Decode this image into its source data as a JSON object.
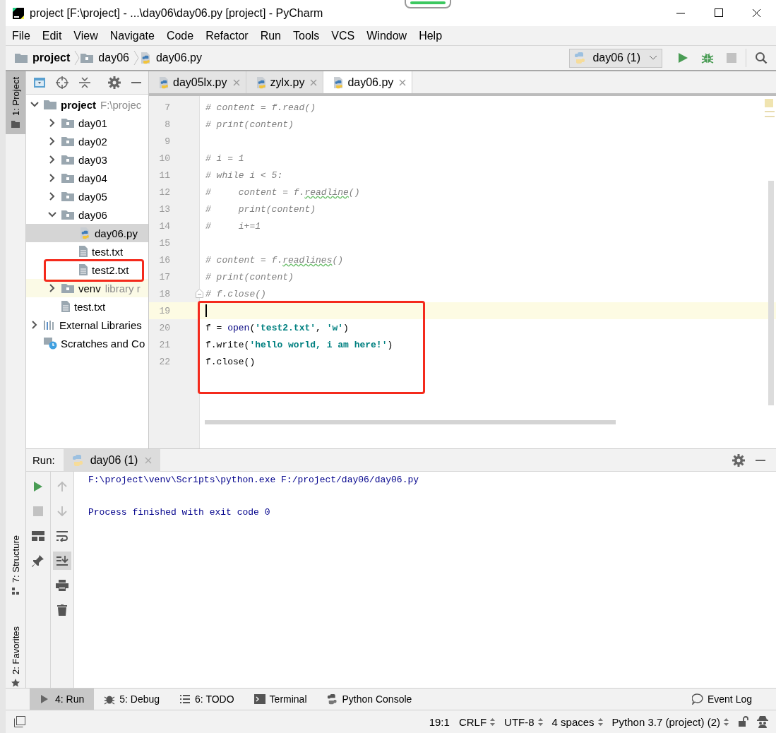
{
  "window": {
    "title": "project [F:\\project] - ...\\day06\\day06.py [project] - PyCharm"
  },
  "menu": [
    "File",
    "Edit",
    "View",
    "Navigate",
    "Code",
    "Refactor",
    "Run",
    "Tools",
    "VCS",
    "Window",
    "Help"
  ],
  "breadcrumbs": [
    {
      "label": "project",
      "kind": "root"
    },
    {
      "label": "day06",
      "kind": "folder"
    },
    {
      "label": "day06.py",
      "kind": "pyfile"
    }
  ],
  "run_config": {
    "label": "day06 (1)"
  },
  "side_tabs_top": [
    {
      "label": "1: Project",
      "selected": true
    }
  ],
  "side_tabs_bottom": [
    {
      "label": "7: Structure",
      "selected": false
    },
    {
      "label": "2: Favorites",
      "selected": false
    }
  ],
  "tree": [
    {
      "label": "project",
      "hint": "F:\\projec",
      "kind": "root",
      "expanded": true,
      "selected": false,
      "children": [
        {
          "label": "day01",
          "kind": "folder",
          "expanded": false,
          "selected": false
        },
        {
          "label": "day02",
          "kind": "folder",
          "expanded": false,
          "selected": false
        },
        {
          "label": "day03",
          "kind": "folder",
          "expanded": false,
          "selected": false
        },
        {
          "label": "day04",
          "kind": "folder",
          "expanded": false,
          "selected": false
        },
        {
          "label": "day05",
          "kind": "folder",
          "expanded": false,
          "selected": false
        },
        {
          "label": "day06",
          "kind": "folder",
          "expanded": true,
          "selected": false,
          "children": [
            {
              "label": "day06.py",
              "kind": "pyfile",
              "selected": true
            },
            {
              "label": "test.txt",
              "kind": "txtfile",
              "selected": false
            },
            {
              "label": "test2.txt",
              "kind": "txtfile",
              "selected": false,
              "annotated": true
            }
          ]
        },
        {
          "label": "venv",
          "hint": "library r",
          "kind": "folder",
          "expanded": false,
          "selected": false,
          "library": true
        },
        {
          "label": "test.txt",
          "kind": "txtfile",
          "selected": false
        }
      ]
    },
    {
      "label": "External Libraries",
      "kind": "libraries",
      "expanded": false,
      "selected": false
    },
    {
      "label": "Scratches and Co",
      "kind": "scratches",
      "selected": false
    }
  ],
  "editor_tabs": [
    {
      "label": "day05lx.py",
      "selected": false
    },
    {
      "label": "zylx.py",
      "selected": false
    },
    {
      "label": "day06.py",
      "selected": true
    }
  ],
  "code": [
    {
      "number": "7",
      "tokens": [
        {
          "kind": "comment",
          "text": "# content = f.read()"
        }
      ]
    },
    {
      "number": "8",
      "tokens": [
        {
          "kind": "comment",
          "text": "# print(content)"
        }
      ]
    },
    {
      "number": "9"
    },
    {
      "number": "10",
      "tokens": [
        {
          "kind": "comment",
          "text": "# i = 1"
        }
      ]
    },
    {
      "number": "11",
      "tokens": [
        {
          "kind": "comment",
          "text": "# while i < 5:"
        }
      ]
    },
    {
      "number": "12",
      "tokens": [
        {
          "kind": "comment",
          "text": "#     content = f."
        },
        {
          "kind": "comment_typo",
          "text": "readline"
        },
        {
          "kind": "comment",
          "text": "()"
        }
      ]
    },
    {
      "number": "13",
      "tokens": [
        {
          "kind": "comment",
          "text": "#     print(content)"
        }
      ]
    },
    {
      "number": "14",
      "tokens": [
        {
          "kind": "comment",
          "text": "#     i+=1"
        }
      ]
    },
    {
      "number": "15"
    },
    {
      "number": "16",
      "tokens": [
        {
          "kind": "comment",
          "text": "# content = f."
        },
        {
          "kind": "comment_typo",
          "text": "readlines"
        },
        {
          "kind": "comment",
          "text": "()"
        }
      ]
    },
    {
      "number": "17",
      "tokens": [
        {
          "kind": "comment",
          "text": "# print(content)"
        }
      ]
    },
    {
      "number": "18",
      "fold": true,
      "tokens": [
        {
          "kind": "comment",
          "text": "# f.close()"
        }
      ]
    },
    {
      "number": "19",
      "current": true,
      "annotated": true
    },
    {
      "number": "20",
      "annotated": true,
      "tokens": [
        {
          "kind": "plain",
          "text": "f = "
        },
        {
          "kind": "builtin",
          "text": "open"
        },
        {
          "kind": "plain",
          "text": "("
        },
        {
          "kind": "string",
          "text": "'test2.txt'"
        },
        {
          "kind": "plain",
          "text": ", "
        },
        {
          "kind": "string",
          "text": "'w'"
        },
        {
          "kind": "plain",
          "text": ")"
        }
      ]
    },
    {
      "number": "21",
      "annotated": true,
      "tokens": [
        {
          "kind": "plain",
          "text": "f.write("
        },
        {
          "kind": "string",
          "text": "'hello world, i am here!'"
        },
        {
          "kind": "plain",
          "text": ")"
        }
      ]
    },
    {
      "number": "22",
      "annotated": true,
      "tokens": [
        {
          "kind": "plain",
          "text": "f.close()"
        }
      ]
    }
  ],
  "run_panel": {
    "label": "Run:",
    "tab": "day06 (1)",
    "output_blocks": [
      {
        "lines": [
          "F:\\project\\venv\\Scripts\\python.exe F:/project/day06/day06.py"
        ]
      },
      {
        "lines": [
          "Process finished with exit code 0"
        ]
      }
    ]
  },
  "tool_windows": [
    {
      "label": "4: Run",
      "kind": "run",
      "selected": true
    },
    {
      "label": "5: Debug",
      "kind": "debug",
      "selected": false
    },
    {
      "label": "6: TODO",
      "kind": "todo",
      "selected": false
    },
    {
      "label": "Terminal",
      "kind": "terminal",
      "selected": false
    },
    {
      "label": "Python Console",
      "kind": "console",
      "selected": false
    }
  ],
  "event_log": {
    "label": "Event Log"
  },
  "status_bar": [
    {
      "label": "19:1",
      "kind": "plain"
    },
    {
      "label": "CRLF",
      "kind": "select"
    },
    {
      "label": "UTF-8",
      "kind": "select"
    },
    {
      "label": "4 spaces",
      "kind": "select"
    },
    {
      "label": "Python 3.7 (project) (2)",
      "kind": "select"
    }
  ]
}
